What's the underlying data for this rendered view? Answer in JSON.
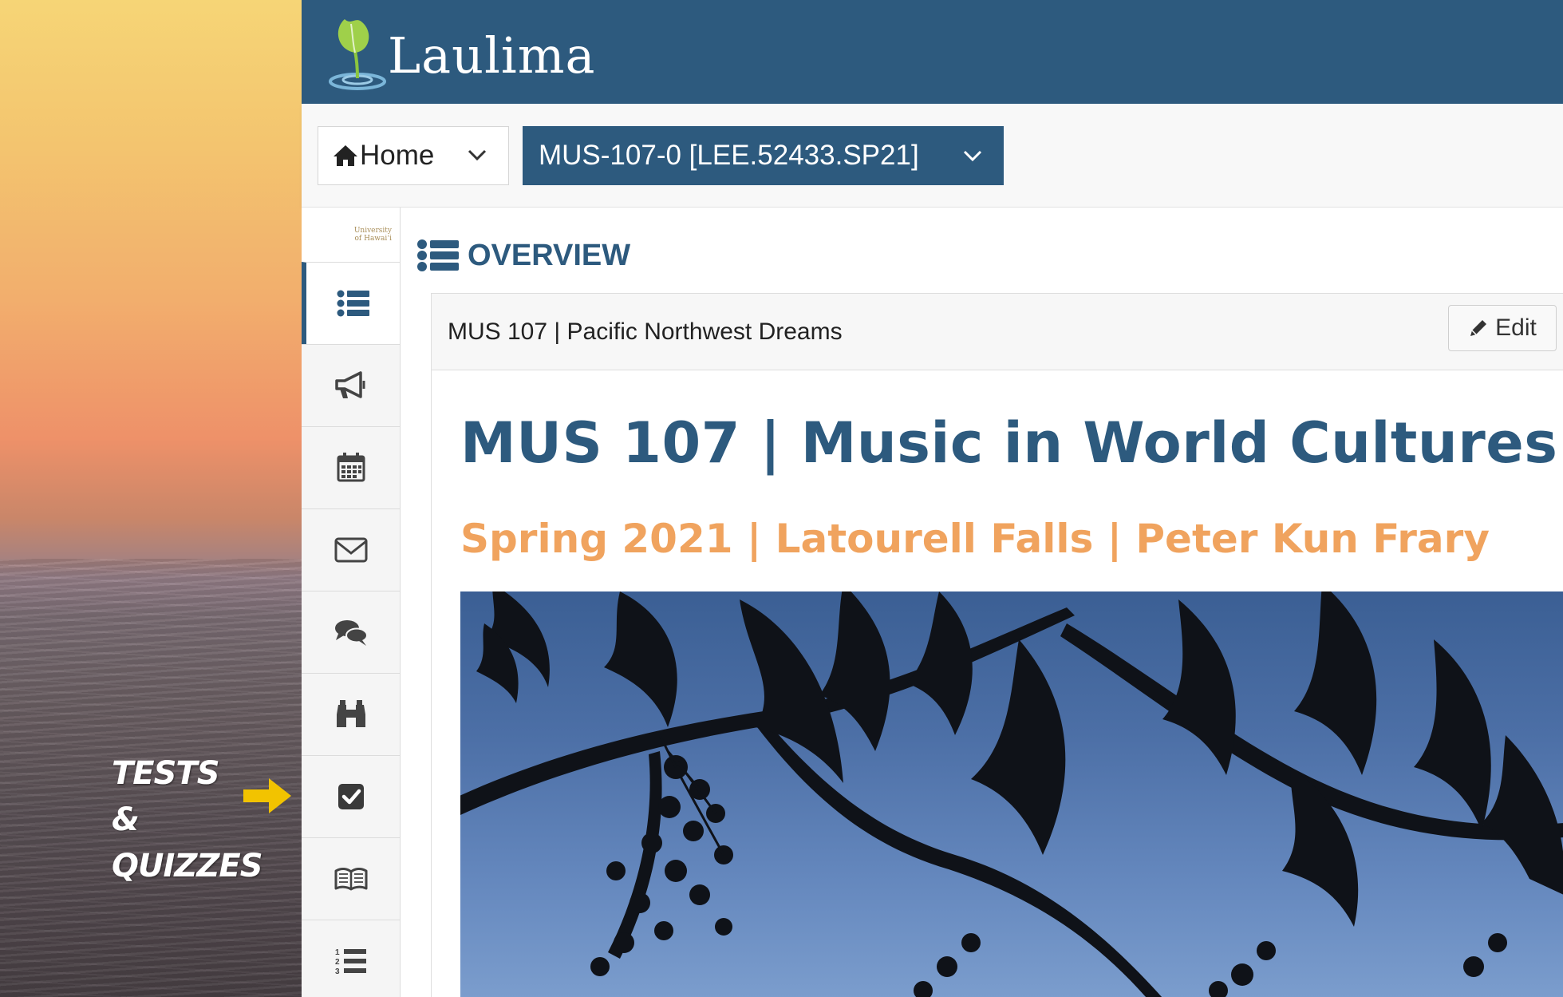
{
  "annotation": {
    "line1": "Tests &",
    "line2": "Quizzes",
    "arrow_color": "#f2c300"
  },
  "header": {
    "logo_text": "Laulima",
    "bar_color": "#2d5a7e"
  },
  "navbar": {
    "home_label": "Home",
    "site_label": "MUS-107-0 [LEE.52433.SP21]"
  },
  "sidebar": {
    "institution_line1": "University",
    "institution_line2": "of Hawai‘i",
    "tools": [
      {
        "icon": "overview-list-icon",
        "active": true
      },
      {
        "icon": "megaphone-icon"
      },
      {
        "icon": "calendar-icon"
      },
      {
        "icon": "envelope-icon"
      },
      {
        "icon": "chat-bubbles-icon"
      },
      {
        "icon": "binoculars-icon"
      },
      {
        "icon": "checkbox-icon"
      },
      {
        "icon": "open-book-icon"
      },
      {
        "icon": "numbered-list-icon"
      }
    ]
  },
  "main": {
    "page_title": "OVERVIEW",
    "panel_title": "MUS 107 | Pacific Northwest Dreams",
    "edit_label": "Edit",
    "course_title": "MUS 107 | Music in World Cultures",
    "course_subtitle": "Spring 2021 | Latourell Falls | Peter Kun Frary",
    "accent_title_color": "#2d5a7e",
    "accent_subtitle_color": "#f0a35e"
  }
}
